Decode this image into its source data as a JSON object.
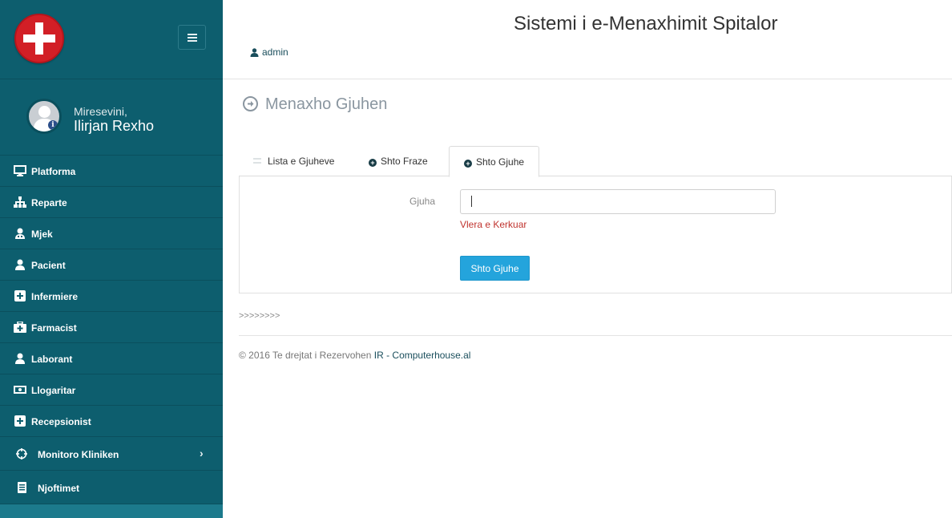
{
  "app": {
    "title": "Sistemi i e-Menaxhimit Spitalor",
    "user_link": "admin"
  },
  "sidebar": {
    "greeting": "Miresevini,",
    "user_name": "Ilirjan Rexho",
    "items": [
      {
        "label": "Platforma",
        "icon": "desktop-icon"
      },
      {
        "label": "Reparte",
        "icon": "sitemap-icon"
      },
      {
        "label": "Mjek",
        "icon": "user-md-icon"
      },
      {
        "label": "Pacient",
        "icon": "user-icon"
      },
      {
        "label": "Infermiere",
        "icon": "plus-square-icon"
      },
      {
        "label": "Farmacist",
        "icon": "medkit-icon"
      },
      {
        "label": "Laborant",
        "icon": "user-icon"
      },
      {
        "label": "Llogaritar",
        "icon": "money-icon"
      },
      {
        "label": "Recepsionist",
        "icon": "plus-square-icon"
      },
      {
        "label": "Monitoro Kliniken",
        "icon": "crosshair-icon"
      },
      {
        "label": "Njoftimet",
        "icon": "list-icon"
      }
    ]
  },
  "page": {
    "heading": "Menaxho Gjuhen"
  },
  "tabs": [
    {
      "label": "Lista e Gjuheve"
    },
    {
      "label": "Shto Fraze"
    },
    {
      "label": "Shto Gjuhe"
    }
  ],
  "form": {
    "label": "Gjuha",
    "value": "",
    "error": "Vlera e Kerkuar",
    "submit_label": "Shto Gjuhe"
  },
  "footer": {
    "arrows": ">>>>>>>>",
    "copyright": "© 2016 Te drejtat i Rezervohen",
    "link": "IR - Computerhouse.al"
  },
  "colors": {
    "sidebar_bg": "#0d5e6e",
    "button": "#24a4dc",
    "error": "#c0332e"
  }
}
